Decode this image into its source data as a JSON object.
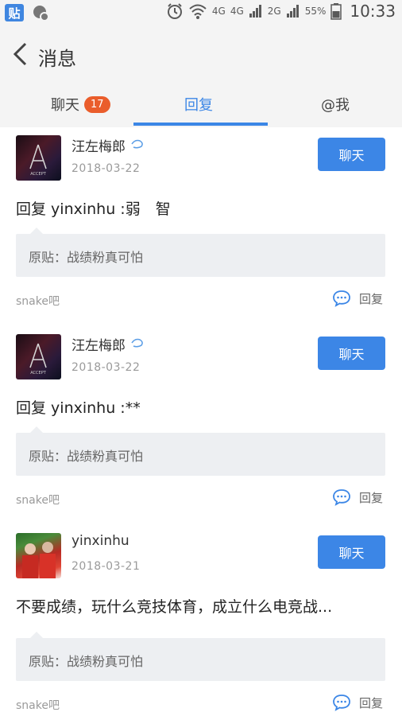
{
  "status_bar": {
    "app_icon_text": "贴",
    "network": "4G",
    "signal1": "4G",
    "signal2": "2G",
    "battery": "55%",
    "time": "10:33"
  },
  "header": {
    "title": "消息"
  },
  "tabs": {
    "chat": {
      "label": "聊天",
      "badge": "17"
    },
    "reply": {
      "label": "回复"
    },
    "at": {
      "label": "@我"
    },
    "active_color": "#3b86e6"
  },
  "messages": [
    {
      "username": "汪左梅郎",
      "date": "2018-03-22",
      "chat_button": "聊天",
      "reply_text": "回复 yinxinhu :弱　智",
      "quote": "原贴：战绩粉真可怕",
      "forum": "snake吧",
      "reply_label": "回复"
    },
    {
      "username": "汪左梅郎",
      "date": "2018-03-22",
      "chat_button": "聊天",
      "reply_text": "回复 yinxinhu :**",
      "quote": "原贴：战绩粉真可怕",
      "forum": "snake吧",
      "reply_label": "回复"
    },
    {
      "username": "yinxinhu",
      "date": "2018-03-21",
      "chat_button": "聊天",
      "reply_text": "不要成绩，玩什么竞技体育，成立什么电竞战...",
      "quote": "原贴：战绩粉真可怕",
      "forum": "snake吧",
      "reply_label": "回复"
    }
  ]
}
